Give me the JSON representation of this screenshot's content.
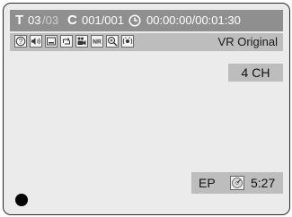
{
  "title_info": {
    "title_glyph": "T",
    "title_current": "03",
    "title_total": "/03",
    "chapter_glyph": "C",
    "chapter": "001/001",
    "time": "00:00:00/00:01:30"
  },
  "icons": [
    "help-icon",
    "audio-icon",
    "subtitle-icon",
    "repeat-icon",
    "angle-icon",
    "noise-reduction-icon",
    "zoom-icon",
    "surround-icon"
  ],
  "nr_label": "NR",
  "disc_type": "VR Original",
  "channel": "4 CH",
  "status": {
    "mode": "EP",
    "remaining": "5:27"
  }
}
